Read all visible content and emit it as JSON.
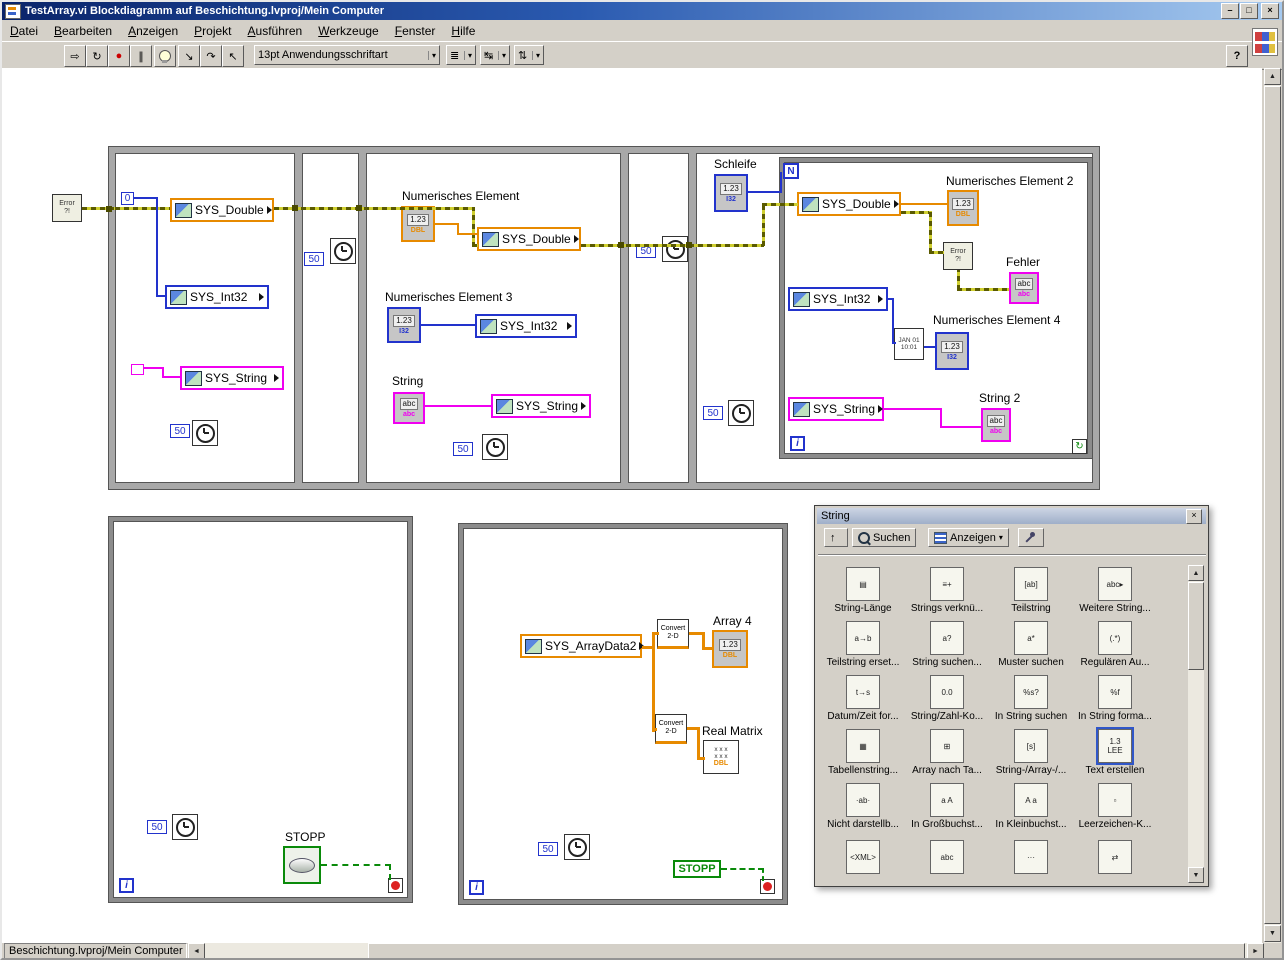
{
  "window": {
    "title": "TestArray.vi Blockdiagramm auf Beschichtung.lvproj/Mein Computer",
    "minimize": "–",
    "maximize": "□",
    "close": "×"
  },
  "menu": {
    "items": [
      "Datei",
      "Bearbeiten",
      "Anzeigen",
      "Projekt",
      "Ausführen",
      "Werkzeuge",
      "Fenster",
      "Hilfe"
    ]
  },
  "toolbar": {
    "font_selector": "13pt Anwendungsschriftart",
    "help": "?",
    "icons": {
      "run": "⇨",
      "run_continuous": "↻",
      "abort": "●",
      "pause": "∥",
      "step_into": "↘",
      "step_over": "↷",
      "step_out": "↖",
      "dropdown": "▾",
      "align": "≣",
      "distribute": "↹",
      "reorder": "⇅"
    }
  },
  "statusbar": {
    "context": "Beschichtung.lvproj/Mein Computer"
  },
  "glyphs": {
    "num": "1.23",
    "dbl": "DBL",
    "i32": "I32",
    "abc": "abc",
    "zero": "0",
    "fifty": "50",
    "error_line1": "Error",
    "error_line2": "?!",
    "datetime": "JAN 01\n10:01",
    "matrix": "x x x\nx x x",
    "continue": "↻",
    "scroll_up": "▲",
    "scroll_down": "▼",
    "scroll_left": "◄",
    "scroll_right": "►"
  },
  "diagram": {
    "frame1": {
      "double": "SYS_Double",
      "int32": "SYS_Int32",
      "string": "SYS_String"
    },
    "frame3": {
      "num_label": "Numerisches Element",
      "double": "SYS_Double",
      "num3_label": "Numerisches Element 3",
      "int32": "SYS_Int32",
      "string_label": "String",
      "string": "SYS_String"
    },
    "frame5": {
      "schleife_label": "Schleife",
      "n": "N",
      "double": "SYS_Double",
      "num2_label": "Numerisches Element 2",
      "fehler_label": "Fehler",
      "int32": "SYS_Int32",
      "num4_label": "Numerisches Element 4",
      "string": "SYS_String",
      "string2_label": "String 2",
      "i": "i"
    },
    "loop1": {
      "i": "i",
      "stop_label": "STOPP"
    },
    "loop2": {
      "node": "SYS_ArrayData2",
      "convert": "Convert\n2-D",
      "array4_label": "Array 4",
      "matrix_label": "Real Matrix",
      "i": "i",
      "stop_label": "STOPP"
    }
  },
  "palette": {
    "title": "String",
    "close": "×",
    "up_icon": "↑",
    "search_label": "Suchen",
    "view_label": "Anzeigen",
    "dropdown": "▾",
    "items": [
      {
        "label": "String-Länge",
        "icon": "▤"
      },
      {
        "label": "Strings verknü...",
        "icon": "≡+"
      },
      {
        "label": "Teilstring",
        "icon": "[ab]"
      },
      {
        "label": "Weitere String...",
        "icon": "abc▸"
      },
      {
        "label": "Teilstring erset...",
        "icon": "a→b"
      },
      {
        "label": "String suchen...",
        "icon": "a?"
      },
      {
        "label": "Muster suchen",
        "icon": "a*"
      },
      {
        "label": "Regulären Au...",
        "icon": "(.*)"
      },
      {
        "label": "Datum/Zeit for...",
        "icon": "t→s"
      },
      {
        "label": "String/Zahl-Ko...",
        "icon": "0.0"
      },
      {
        "label": "In String suchen",
        "icon": "%s?"
      },
      {
        "label": "In String forma...",
        "icon": "%f"
      },
      {
        "label": "Tabellenstring...",
        "icon": "▦"
      },
      {
        "label": "Array nach Ta...",
        "icon": "⊞"
      },
      {
        "label": "String-/Array-/...",
        "icon": "[s]"
      },
      {
        "label": "Text erstellen",
        "icon": "1.3\nLEE"
      },
      {
        "label": "Nicht darstellb...",
        "icon": "·ab·"
      },
      {
        "label": "In Großbuchst...",
        "icon": "a A"
      },
      {
        "label": "In Kleinbuchst...",
        "icon": "A a"
      },
      {
        "label": "Leerzeichen-K...",
        "icon": "▫"
      },
      {
        "label": "",
        "icon": "<XML>"
      },
      {
        "label": "",
        "icon": "abc"
      },
      {
        "label": "",
        "icon": "···"
      },
      {
        "label": "",
        "icon": "⇄"
      }
    ]
  }
}
